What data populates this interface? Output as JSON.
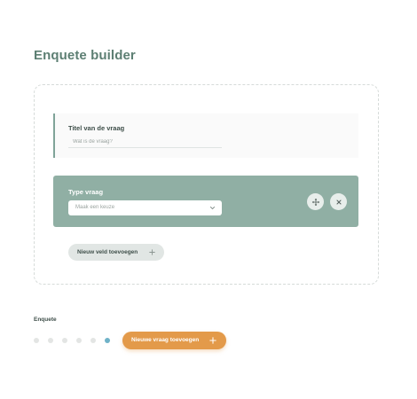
{
  "page": {
    "title": "Enquete builder"
  },
  "question_field": {
    "label": "Titel van de vraag",
    "placeholder": "Wat is de vraag?",
    "value": ""
  },
  "type_panel": {
    "label": "Type vraag",
    "select_placeholder": "Maak een keuze",
    "move_icon": "move-icon",
    "close_icon": "close-icon"
  },
  "add_field": {
    "label": "Nieuw veld toevoegen",
    "icon": "plus-icon"
  },
  "survey": {
    "label": "Enquete",
    "steps_total": 6,
    "active_step": 6,
    "new_question_label": "Nieuwe vraag toevoegen",
    "new_question_icon": "plus-icon"
  },
  "colors": {
    "title": "#5d7f73",
    "panel": "#90afa4",
    "accent_orange": "#e39a4a",
    "active_dot": "#6fb2c8"
  }
}
